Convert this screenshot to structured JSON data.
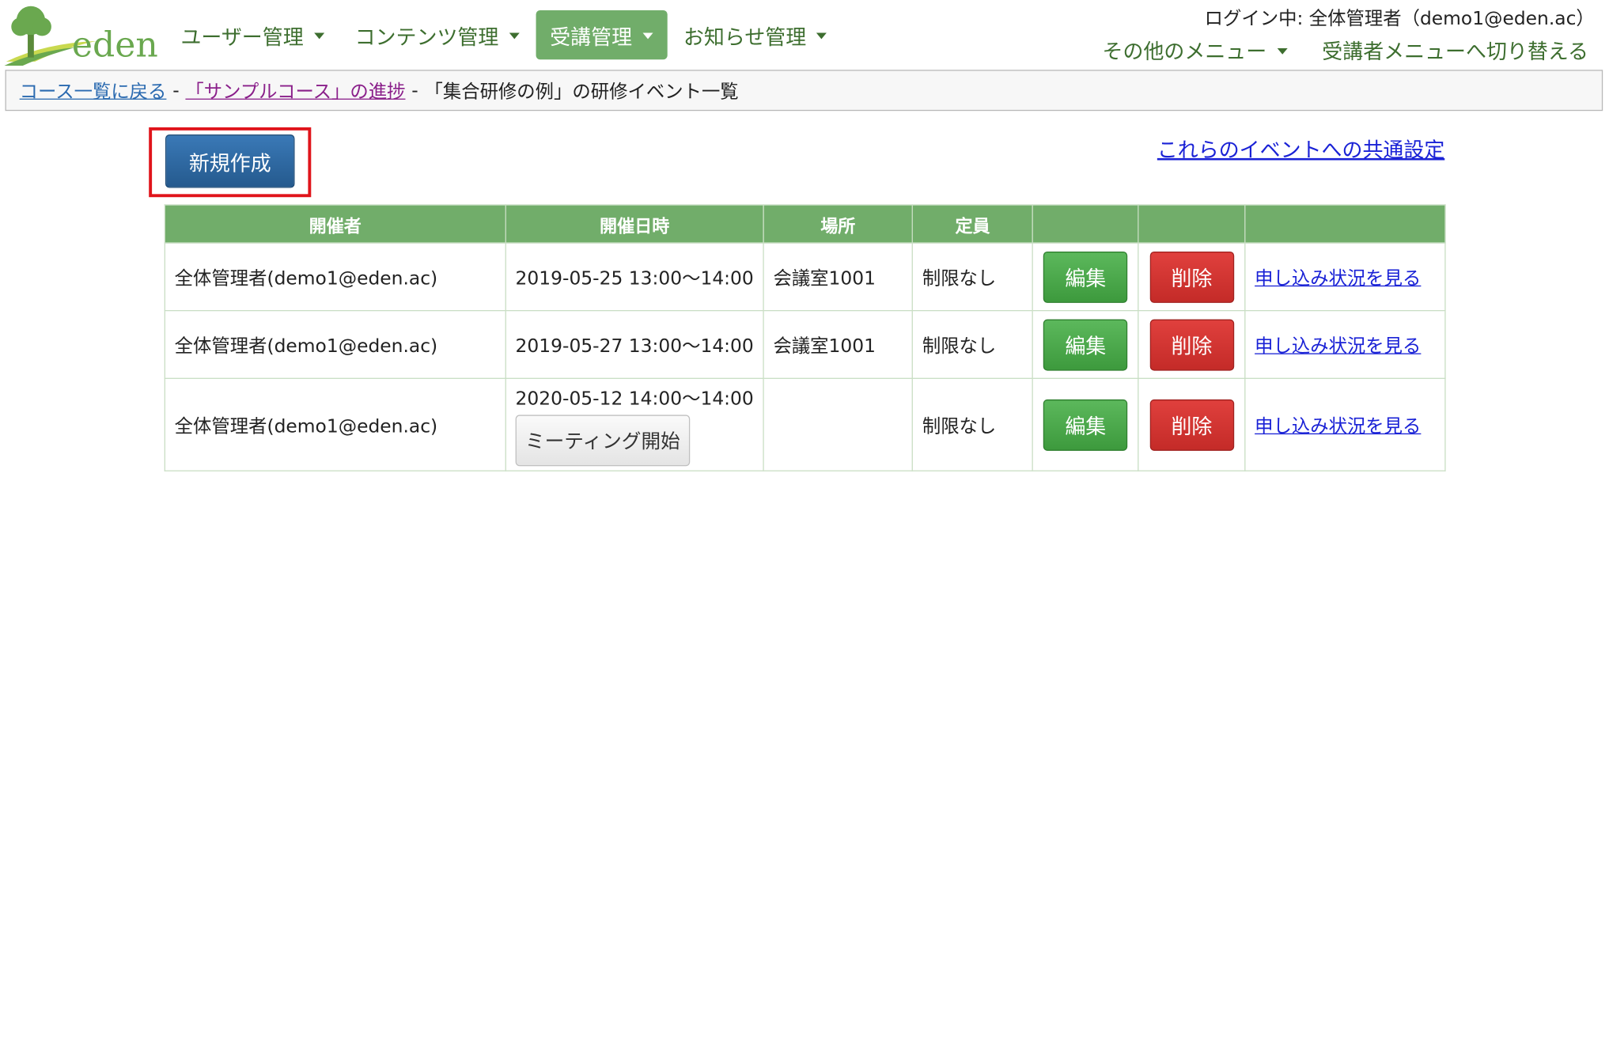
{
  "header": {
    "logo_text": "eden",
    "nav": [
      {
        "label": "ユーザー管理"
      },
      {
        "label": "コンテンツ管理"
      },
      {
        "label": "受講管理"
      },
      {
        "label": "お知らせ管理"
      }
    ],
    "login_status": "ログイン中: 全体管理者（demo1@eden.ac）",
    "other_menu": "その他のメニュー",
    "switch_menu": "受講者メニューへ切り替える"
  },
  "breadcrumb": {
    "back_link": "コース一覧に戻る",
    "sep": "-",
    "progress_link": "「サンプルコース」の進捗",
    "current": "「集合研修の例」の研修イベント一覧"
  },
  "actions": {
    "new_label": "新規作成",
    "common_settings": "これらのイベントへの共通設定"
  },
  "table": {
    "headers": [
      "開催者",
      "開催日時",
      "場所",
      "定員",
      "",
      "",
      ""
    ],
    "rows": [
      {
        "organizer": "全体管理者(demo1@eden.ac)",
        "datetime": "2019-05-25 13:00〜14:00",
        "place": "会議室1001",
        "capacity": "制限なし",
        "edit": "編集",
        "delete": "削除",
        "status": "申し込み状況を見る"
      },
      {
        "organizer": "全体管理者(demo1@eden.ac)",
        "datetime": "2019-05-27 13:00〜14:00",
        "place": "会議室1001",
        "capacity": "制限なし",
        "edit": "編集",
        "delete": "削除",
        "status": "申し込み状況を見る"
      },
      {
        "organizer": "全体管理者(demo1@eden.ac)",
        "datetime": "2020-05-12 14:00〜14:00",
        "meeting_button": "ミーティング開始",
        "place": "",
        "capacity": "制限なし",
        "edit": "編集",
        "delete": "削除",
        "status": "申し込み状況を見る"
      }
    ]
  },
  "colors": {
    "nav_green": "#3d6e2f",
    "header_green": "#71ad6a",
    "primary_blue": "#255a8e",
    "edit_green": "#5cb85c",
    "delete_red": "#d9534f",
    "highlight_red": "#e0141b",
    "link_blue": "#1a22d6"
  }
}
